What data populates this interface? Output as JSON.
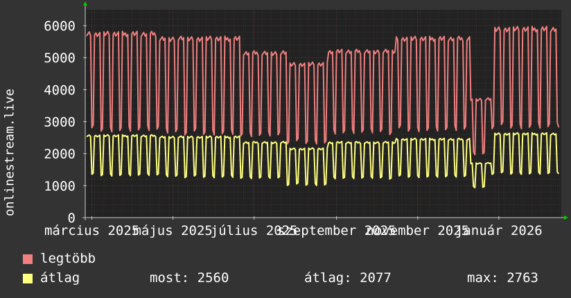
{
  "chart_data": {
    "type": "line",
    "ylabel": "onlinestream.live",
    "ylim": [
      0,
      6500
    ],
    "yticks": [
      0,
      1000,
      2000,
      3000,
      4000,
      5000,
      6000
    ],
    "xlim": [
      "2025-02-24",
      "2026-02-17"
    ],
    "xticks": [
      {
        "date": "2025-03-01",
        "label": "március 2025"
      },
      {
        "date": "2025-05-01",
        "label": "május 2025"
      },
      {
        "date": "2025-07-01",
        "label": "július 2025"
      },
      {
        "date": "2025-09-01",
        "label": "szeptember 2025"
      },
      {
        "date": "2025-11-01",
        "label": "november 2025"
      },
      {
        "date": "2026-01-01",
        "label": "január 2026"
      }
    ],
    "grid": true,
    "series": [
      {
        "name": "legtöbb",
        "color": "#f07f7f",
        "segments": [
          {
            "from": "2025-02-25",
            "to": "2025-04-20",
            "high": 5750,
            "low": 2800
          },
          {
            "from": "2025-04-21",
            "to": "2025-06-20",
            "high": 5600,
            "low": 2700
          },
          {
            "from": "2025-06-21",
            "to": "2025-07-25",
            "high": 5150,
            "low": 2600
          },
          {
            "from": "2025-07-26",
            "to": "2025-08-25",
            "high": 4800,
            "low": 2400
          },
          {
            "from": "2025-08-26",
            "to": "2025-10-15",
            "high": 5200,
            "low": 2700
          },
          {
            "from": "2025-10-16",
            "to": "2025-12-10",
            "high": 5600,
            "low": 2800
          },
          {
            "from": "2025-12-11",
            "to": "2025-12-26",
            "high": 3700,
            "low": 2000
          },
          {
            "from": "2025-12-27",
            "to": "2026-02-15",
            "high": 5900,
            "low": 2900
          }
        ]
      },
      {
        "name": "átlag",
        "color": "#ffff80",
        "segments": [
          {
            "from": "2025-02-25",
            "to": "2025-04-20",
            "high": 2560,
            "low": 1350
          },
          {
            "from": "2025-04-21",
            "to": "2025-06-20",
            "high": 2520,
            "low": 1300
          },
          {
            "from": "2025-06-21",
            "to": "2025-07-25",
            "high": 2350,
            "low": 1250
          },
          {
            "from": "2025-07-26",
            "to": "2025-08-25",
            "high": 2150,
            "low": 1050
          },
          {
            "from": "2025-08-26",
            "to": "2025-10-15",
            "high": 2350,
            "low": 1250
          },
          {
            "from": "2025-10-16",
            "to": "2025-12-10",
            "high": 2450,
            "low": 1300
          },
          {
            "from": "2025-12-11",
            "to": "2025-12-26",
            "high": 1700,
            "low": 950
          },
          {
            "from": "2025-12-27",
            "to": "2026-02-15",
            "high": 2620,
            "low": 1400
          }
        ]
      }
    ]
  },
  "legend": {
    "max_label": "legtöbb",
    "avg_label": "átlag",
    "max_color": "#f07f7f",
    "avg_color": "#ffff80"
  },
  "stats": {
    "most": "most: 2560",
    "atlag": "átlag: 2077",
    "max": "max: 2763"
  },
  "colors": {
    "background": "#333333",
    "plot_background": "#222222",
    "grid": "#5a3a3a",
    "axis": "#cccccc"
  }
}
